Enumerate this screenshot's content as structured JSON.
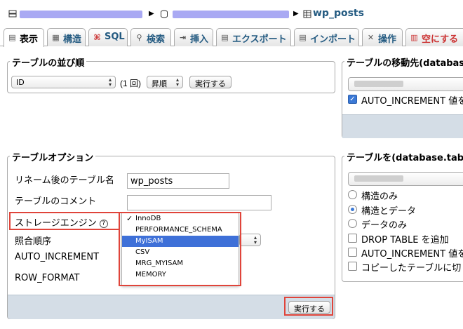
{
  "breadcrumb": {
    "table_name": "wp_posts"
  },
  "tabs": [
    {
      "label": "表示",
      "icon": "table-browse-icon",
      "active": true
    },
    {
      "label": "構造",
      "icon": "structure-icon"
    },
    {
      "label": "SQL",
      "icon": "sql-icon"
    },
    {
      "label": "検索",
      "icon": "search-icon"
    },
    {
      "label": "挿入",
      "icon": "insert-icon"
    },
    {
      "label": "エクスポート",
      "icon": "export-icon"
    },
    {
      "label": "インポート",
      "icon": "import-icon"
    },
    {
      "label": "操作",
      "icon": "tools-icon"
    },
    {
      "label": "空にする",
      "icon": "empty-icon"
    }
  ],
  "sort_panel": {
    "legend": "テーブルの並び順",
    "column_select": "ID",
    "paren_text": "(1 回)",
    "order_select": "昇順",
    "go_label": "実行する"
  },
  "move_panel": {
    "legend": "テーブルの移動先(database",
    "auto_increment_label": "AUTO_INCREMENT 値を",
    "auto_increment_checked": true
  },
  "options_panel": {
    "legend": "テーブルオプション",
    "rename_label": "リネーム後のテーブル名",
    "rename_value": "wp_posts",
    "comment_label": "テーブルのコメント",
    "comment_value": "",
    "engine_label": "ストレージエンジン",
    "help_glyph": "?",
    "collation_label": "照合順序",
    "auto_increment_label": "AUTO_INCREMENT",
    "row_format_label": "ROW_FORMAT",
    "go_label": "実行する"
  },
  "engine_dropdown": {
    "options": [
      "InnoDB",
      "PERFORMANCE_SCHEMA",
      "MyISAM",
      "CSV",
      "MRG_MYISAM",
      "MEMORY"
    ],
    "checked": "InnoDB",
    "highlighted": "MyISAM",
    "check_glyph": "✓"
  },
  "copy_panel": {
    "legend": "テーブルを(database.table",
    "options": [
      {
        "label": "構造のみ",
        "type": "radio",
        "checked": false
      },
      {
        "label": "構造とデータ",
        "type": "radio",
        "checked": true
      },
      {
        "label": "データのみ",
        "type": "radio",
        "checked": false
      },
      {
        "label": "DROP TABLE を追加",
        "type": "checkbox",
        "checked": false
      },
      {
        "label": "AUTO_INCREMENT 値を",
        "type": "checkbox",
        "checked": false
      },
      {
        "label": "コピーしたテーブルに切",
        "type": "checkbox",
        "checked": false
      }
    ]
  },
  "colors": {
    "link": "#235a81",
    "highlight": "#3e70d8",
    "annotation": "#e0443a",
    "footer": "#d4dde6"
  }
}
